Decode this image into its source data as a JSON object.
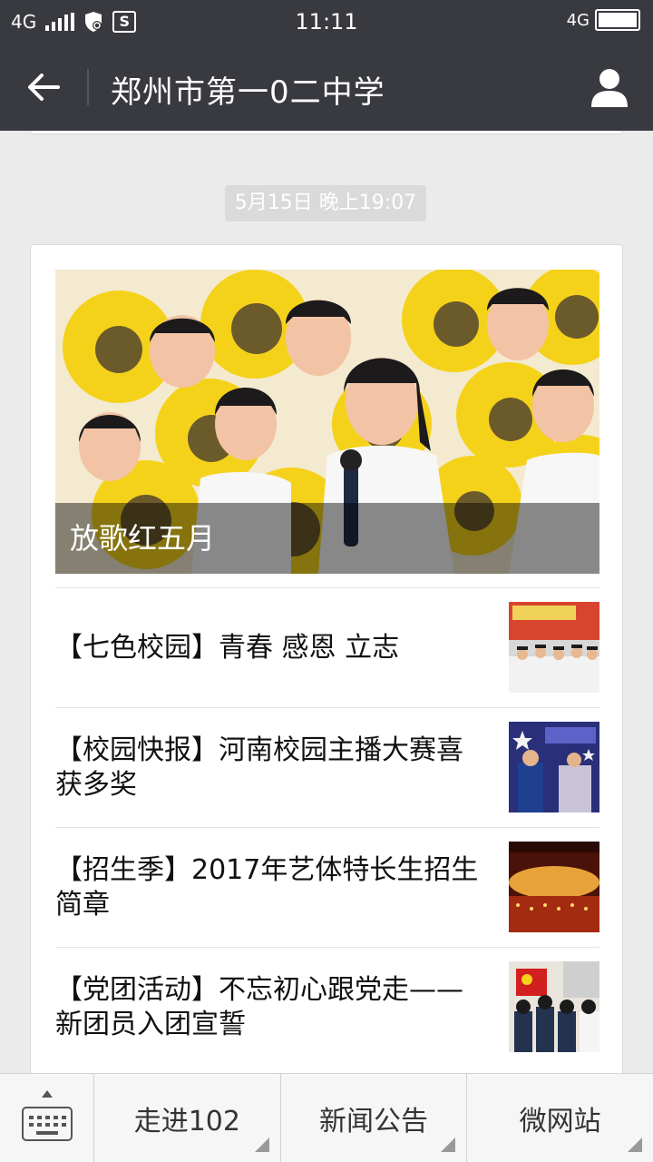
{
  "status_bar": {
    "network": "4G",
    "time": "11:11",
    "network_right": "4G",
    "s_badge": "S",
    "battery_level": 1.0
  },
  "header": {
    "title": "郑州市第一0二中学"
  },
  "timestamp": "5月15日 晚上19:07",
  "hero": {
    "caption": "放歌红五月"
  },
  "news": [
    {
      "title": "【七色校园】青春 感恩 立志"
    },
    {
      "title": "【校园快报】河南校园主播大赛喜获多奖"
    },
    {
      "title": "【招生季】2017年艺体特长生招生简章"
    },
    {
      "title": "【党团活动】不忘初心跟党走——新团员入团宣誓"
    }
  ],
  "bottom_menu": {
    "items": [
      {
        "label": "走进102"
      },
      {
        "label": "新闻公告"
      },
      {
        "label": "微网站"
      }
    ]
  },
  "colors": {
    "nav_bg": "#393a3f",
    "page_bg": "#ebebeb",
    "timestamp_bg": "#dadada"
  }
}
